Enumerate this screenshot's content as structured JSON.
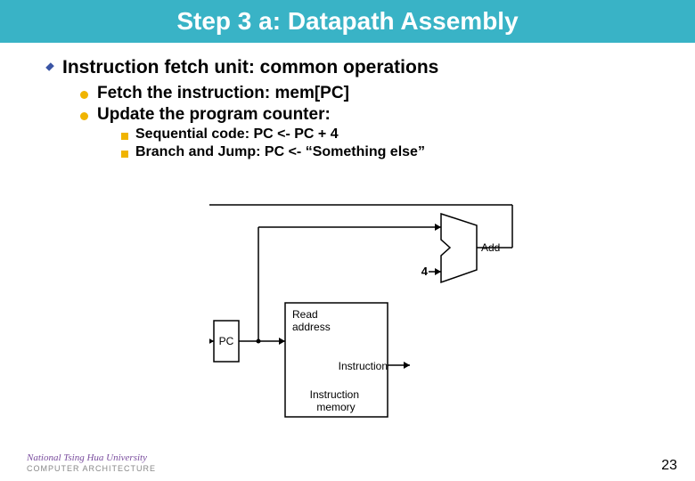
{
  "title": "Step 3 a: Datapath Assembly",
  "bullets": {
    "lvl1": "Instruction fetch unit: common operations",
    "lvl2_a": "Fetch the instruction: mem[PC]",
    "lvl2_b": "Update the program counter:",
    "lvl3_a": "Sequential code: PC <- PC + 4",
    "lvl3_b": "Branch and Jump:   PC <- “Something else”"
  },
  "diagram": {
    "pc": "PC",
    "read_addr": "Read\naddress",
    "instr_mem": "Instruction\nmemory",
    "instruction": "Instruction",
    "add": "Add",
    "four": "4"
  },
  "footer": {
    "university": "National Tsing Hua University",
    "dept": "COMPUTER  ARCHITECTURE",
    "page": "23"
  }
}
